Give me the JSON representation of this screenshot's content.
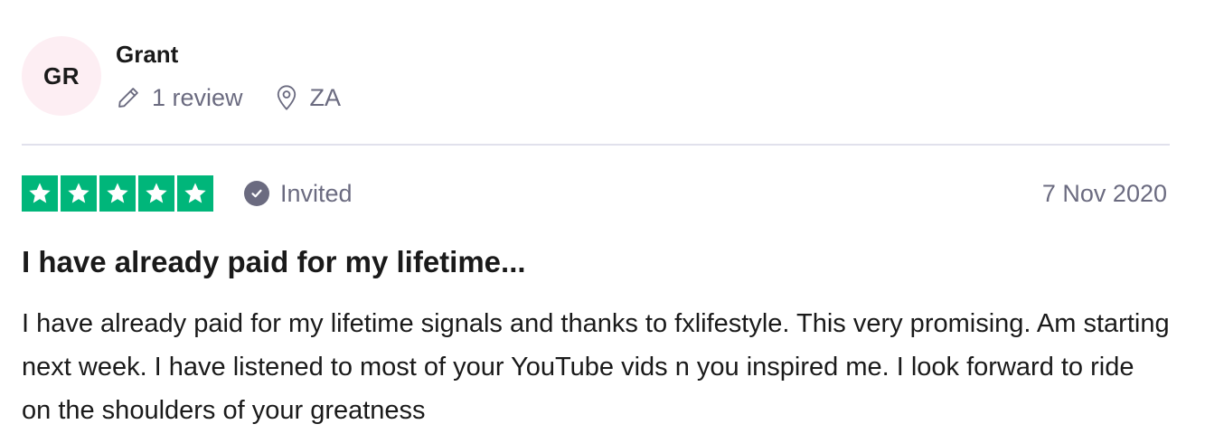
{
  "consumer": {
    "initials": "GR",
    "avatar_bg": "#fdeef3",
    "name": "Grant",
    "review_count": "1 review",
    "review_count_icon": "pencil-icon",
    "location": "ZA",
    "location_icon": "location-pin-icon"
  },
  "rating": {
    "stars": 5,
    "max_stars": 5,
    "star_color": "#00b67a",
    "badge_icon": "check-circle-icon",
    "badge_label": "Invited",
    "date": "7 Nov 2020"
  },
  "review": {
    "title": "I have already paid for my lifetime...",
    "body": "I have already paid for my lifetime signals and thanks to fxlifestyle. This very promising. Am starting next week. I have listened to most of your YouTube vids n you inspired me. I look forward to ride on the shoulders of your greatness"
  },
  "colors": {
    "muted_text": "#6b6b80",
    "divider": "#e1e1ec"
  }
}
